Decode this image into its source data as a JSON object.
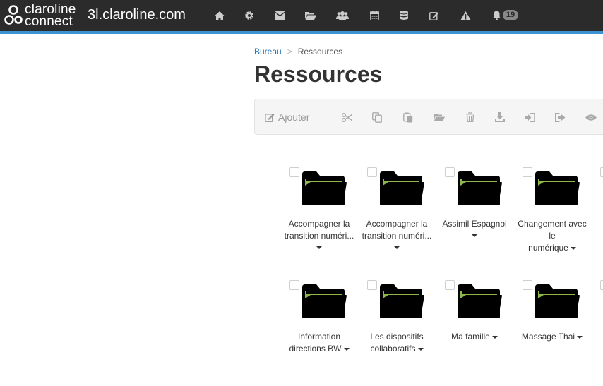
{
  "brand": {
    "logo_line1": "claroline",
    "logo_line2": "connect",
    "site_name": "3l.claroline.com"
  },
  "navbar": {
    "icons": [
      "home-icon",
      "gear-icon",
      "envelope-icon",
      "folder-open-icon",
      "users-icon",
      "calendar-icon",
      "database-icon",
      "edit-icon",
      "warning-icon",
      "bell-icon"
    ],
    "notification_count": "19"
  },
  "breadcrumb": {
    "root": "Bureau",
    "separator": ">",
    "current": "Ressources"
  },
  "page": {
    "title": "Ressources"
  },
  "toolbar": {
    "add_label": "Ajouter",
    "icons": [
      "scissors-icon",
      "copy-icon",
      "paste-icon",
      "folder-open-icon",
      "trash-icon",
      "download-icon",
      "sign-in-icon",
      "sign-out-icon",
      "eye-icon"
    ]
  },
  "resources": {
    "row1": [
      {
        "line1": "Accompagner la",
        "line2": "transition numéri..."
      },
      {
        "line1": "Accompagner la",
        "line2": "transition numéri..."
      },
      {
        "line1": "Assimil Espagnol",
        "line2": ""
      },
      {
        "line1": "Changement avec le",
        "line2": "numérique"
      }
    ],
    "row2": [
      {
        "line1": "Information",
        "line2": "directions BW"
      },
      {
        "line1": "Les dispositifs",
        "line2": "collaboratifs"
      },
      {
        "line1": "Ma famille",
        "line2": ""
      },
      {
        "line1": "Massage Thai",
        "line2": ""
      }
    ]
  },
  "colors": {
    "navbar": "#2b2b2b",
    "accent": "#3c94d3",
    "folder_body": "#000000",
    "folder_inner": "#8cb84a",
    "link": "#2a78b8"
  }
}
